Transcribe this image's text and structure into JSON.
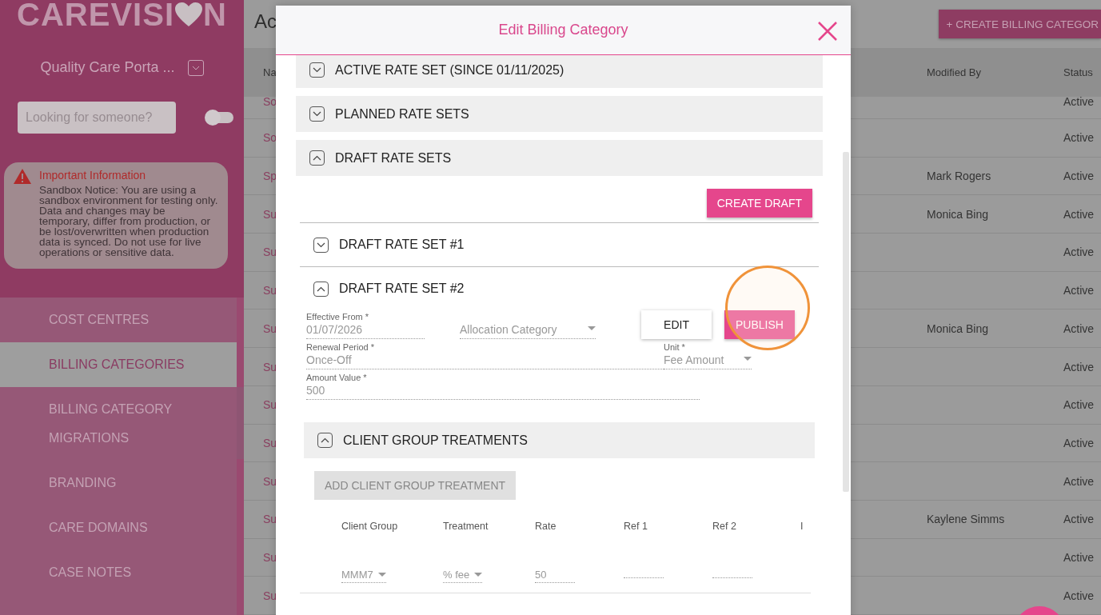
{
  "sidebar": {
    "logo": {
      "before": "CAREVISI",
      "after": "N"
    },
    "organisation": "Quality Care Porta ...",
    "search": {
      "placeholder": "Looking for someone?"
    },
    "toggle": {
      "on": false
    },
    "notice": {
      "title": "Important Information",
      "text": "Sandbox Notice: You are using a sandbox environment for testing only. Data and changes may be temporary, differ from production, or be lost/overwritten when production data is synced. Do not use for live operations or sensitive data."
    },
    "nav": [
      {
        "label": "COST CENTRES",
        "selected": false
      },
      {
        "label": "BILLING CATEGORIES",
        "selected": true
      },
      {
        "label": "BILLING CATEGORY MIGRATIONS",
        "selected": false
      },
      {
        "label": "BRANDING",
        "selected": false
      },
      {
        "label": "CARE DOMAINS",
        "selected": false
      },
      {
        "label": "CASE NOTES",
        "selected": false
      }
    ]
  },
  "page": {
    "title": "Ac",
    "create_button": "+ CREATE BILLING CATEGOR",
    "columns": [
      "Na",
      "Modified By",
      "Status"
    ],
    "rows": [
      {
        "name": "So",
        "status": "Active"
      },
      {
        "name": "So",
        "status": "Active"
      },
      {
        "name": "Sp",
        "modified_by": "Mark Rogers",
        "status": "Active"
      },
      {
        "name": "Su",
        "modified_by": "Monica Bing",
        "status": "Active"
      },
      {
        "name": "Su",
        "status": "Active"
      },
      {
        "name": "Su",
        "status": "Active"
      },
      {
        "name": "Su",
        "modified_by": "Monica Bing",
        "status": "Active"
      },
      {
        "name": "Su",
        "status": "Active"
      },
      {
        "name": "Su",
        "status": "Active"
      },
      {
        "name": "Su",
        "status": "Active"
      },
      {
        "name": "Su",
        "status": "Active"
      },
      {
        "name": "Su",
        "modified_by": "Kaylene Simms",
        "status": "Active"
      },
      {
        "name": "Su",
        "status": "Active"
      },
      {
        "name": "Su",
        "status": "Active"
      }
    ]
  },
  "modal": {
    "title": "Edit Billing Category",
    "sections": [
      {
        "label": "ACTIVE RATE SET (SINCE 01/11/2025)",
        "expanded": false
      },
      {
        "label": "PLANNED RATE SETS",
        "expanded": false
      },
      {
        "label": "DRAFT RATE SETS",
        "expanded": true
      }
    ],
    "create_draft": "CREATE DRAFT",
    "draft_sets": [
      {
        "label": "DRAFT RATE SET #1",
        "expanded": false
      },
      {
        "label": "DRAFT RATE SET #2",
        "expanded": true
      }
    ],
    "form": {
      "effective_from": {
        "label": "Effective From *",
        "value": "01/07/2026"
      },
      "allocation_category": {
        "placeholder": "Allocation Category"
      },
      "edit_button": "EDIT",
      "publish_button": "PUBLISH",
      "renewal_period": {
        "label": "Renewal Period *",
        "value": "Once-Off"
      },
      "unit": {
        "label": "Unit *",
        "value": "Fee Amount"
      },
      "amount_value": {
        "label": "Amount Value *",
        "value": "500"
      }
    },
    "client_group": {
      "label": "CLIENT GROUP TREATMENTS",
      "expanded": true,
      "add_button": {
        "label": "ADD CLIENT GROUP TREATMENT",
        "disabled": true
      },
      "columns": [
        "Client Group",
        "Treatment",
        "Rate",
        "Ref 1",
        "Ref 2",
        "I"
      ],
      "rows": [
        {
          "client_group": "MMM7",
          "treatment": "% fee",
          "rate": "50"
        }
      ]
    }
  }
}
